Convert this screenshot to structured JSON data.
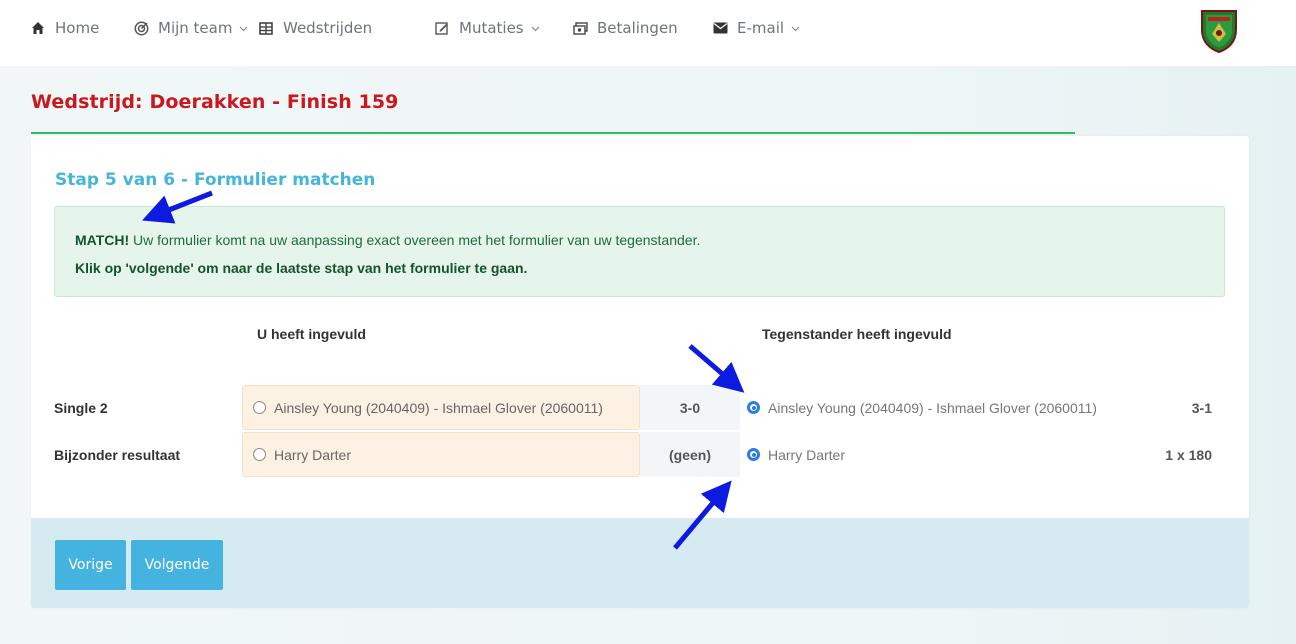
{
  "nav": {
    "home": "Home",
    "team": "Mijn team",
    "matches": "Wedstrijden",
    "mutations": "Mutaties",
    "payments": "Betalingen",
    "email": "E-mail"
  },
  "page": {
    "title": "Wedstrijd: Doerakken - Finish 159"
  },
  "step": {
    "title": "Stap 5 van 6 - Formulier matchen"
  },
  "alert": {
    "strong": "MATCH!",
    "message": " Uw formulier komt na uw aanpassing exact overeen met het formulier van uw tegenstander.",
    "instruction": "Klik op 'volgende' om naar de laatste stap van het formulier te gaan."
  },
  "table": {
    "header_mine": "U heeft ingevuld",
    "header_opponent": "Tegenstander heeft ingevuld",
    "rows": [
      {
        "label": "Single 2",
        "mine": "Ainsley Young (2040409) - Ishmael Glover (2060011)",
        "mine_score": "3-0",
        "opponent": "Ainsley Young (2040409) - Ishmael Glover (2060011)",
        "opponent_score": "3-1"
      },
      {
        "label": "Bijzonder resultaat",
        "mine": "Harry Darter",
        "mine_score": "(geen)",
        "opponent": "Harry Darter",
        "opponent_score": "1 x 180"
      }
    ]
  },
  "buttons": {
    "previous": "Vorige",
    "next": "Volgende"
  },
  "colors": {
    "title_red": "#c9181e",
    "step_blue": "#45b5d9",
    "button_blue": "#44b3e0",
    "success_green": "#2ebc5e",
    "annotation_arrow": "#0d1be0"
  },
  "icons": {
    "home": "home-icon",
    "team": "target-icon",
    "matches": "table-icon",
    "mutations": "edit-icon",
    "payments": "money-icon",
    "email": "envelope-icon"
  }
}
